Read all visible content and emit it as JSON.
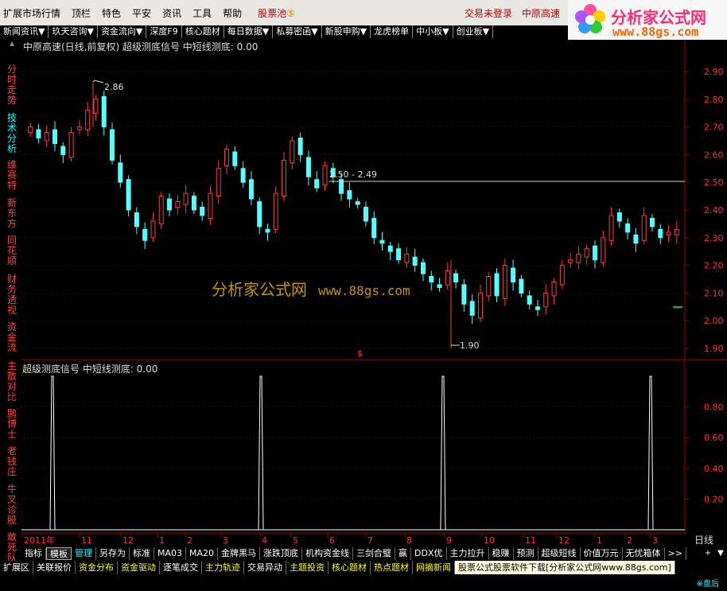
{
  "menu": {
    "items": [
      "扩展市场行情",
      "顶栏",
      "特色",
      "平安",
      "资讯",
      "工具",
      "帮助"
    ],
    "stock_pool": "股票池",
    "stock_pool_badge": "⑤",
    "login": "交易未登录",
    "current_stock": "中原高速"
  },
  "logo": {
    "brand": "分析家公式网",
    "url": "www.88gs.com"
  },
  "nav": [
    "新闻资讯▼",
    "玖天咨询▼",
    "资金流向▼",
    "深度F9",
    "核心题材",
    "每日数据▼",
    "私募密函▼",
    "新股申购▼",
    "龙虎榜单",
    "中小板▼",
    "创业板▼"
  ],
  "sidebar": [
    {
      "label": "分时走势",
      "active": false
    },
    {
      "label": "技术分析",
      "active": true
    },
    {
      "label": "维赛特",
      "active": false
    },
    {
      "label": "新东方",
      "active": false
    },
    {
      "label": "同花顺",
      "active": false
    },
    {
      "label": "财务透视",
      "active": false
    },
    {
      "label": "资金流",
      "active": false
    },
    {
      "label": "主散对比",
      "active": false
    },
    {
      "label": "鹏博士",
      "active": false
    },
    {
      "label": "老钱庄",
      "active": false
    },
    {
      "label": "牛叉诊股",
      "active": false
    },
    {
      "label": "敢死队",
      "active": false
    }
  ],
  "main_title": "中原高速(日线,前复权) 超级测底信号  中短线测底: 0.00",
  "sub_title": "超级测底信号  中短线测底: 0.00",
  "watermark": {
    "text": "分析家公式网",
    "url": "www.88gs.com"
  },
  "toolbar1": [
    "指标",
    "模板",
    "管理",
    "另存为",
    "标准",
    "MA03",
    "MA20",
    "金牌黑马",
    "涨跌顶底",
    "机构资金线",
    "三剑合璧",
    "赢",
    "DDX优",
    "主力拉升",
    "稳赚",
    "预测",
    "超级短线",
    "价值万元",
    "无忧箱体",
    ">>"
  ],
  "toolbar2": [
    "扩展区",
    "关联报价",
    "资金分布",
    "资金驱动",
    "逐笔成交",
    "主力轨迹",
    "交易异动",
    "主题投资",
    "核心题材",
    "热点题材",
    "网摘新闻"
  ],
  "ad_text": "股票公式股票软件下载[分析家公式网www.88gs.com]",
  "status_right": "※盘后",
  "period": "日线",
  "chart_data": [
    {
      "type": "candlestick",
      "title": "中原高速(日线,前复权)",
      "y_ticks": [
        "2.90",
        "2.80",
        "2.70",
        "2.60",
        "2.50",
        "2.40",
        "2.30",
        "2.20",
        "2.10",
        "2.00",
        "1.90"
      ],
      "ylim": [
        1.85,
        2.95
      ],
      "x_ticks": [
        "2011年",
        "11",
        "12",
        "1",
        "2",
        "3",
        "4",
        "5",
        "6",
        "7",
        "8",
        "9",
        "10",
        "11",
        "12",
        "1",
        "2",
        "3"
      ],
      "annotations": [
        "2.86",
        "2.50 - 2.49",
        "1.90"
      ],
      "high": 2.86,
      "low": 1.9,
      "horizontal_line": 2.5,
      "close_series": [
        2.7,
        2.66,
        2.68,
        2.64,
        2.6,
        2.68,
        2.7,
        2.76,
        2.8,
        2.7,
        2.58,
        2.5,
        2.4,
        2.34,
        2.29,
        2.36,
        2.45,
        2.4,
        2.43,
        2.46,
        2.4,
        2.38,
        2.46,
        2.55,
        2.62,
        2.56,
        2.5,
        2.44,
        2.34,
        2.32,
        2.46,
        2.58,
        2.65,
        2.6,
        2.52,
        2.48,
        2.56,
        2.52,
        2.46,
        2.44,
        2.42,
        2.36,
        2.3,
        2.28,
        2.25,
        2.22,
        2.24,
        2.2,
        2.17,
        2.14,
        2.12,
        2.18,
        2.14,
        2.06,
        2.02,
        2.1,
        2.16,
        2.09,
        2.2,
        2.14,
        2.1,
        2.06,
        2.04,
        2.1,
        2.14,
        2.2,
        2.22,
        2.24,
        2.26,
        2.22,
        2.3,
        2.38,
        2.36,
        2.32,
        2.28,
        2.38,
        2.34,
        2.3,
        2.32,
        2.33
      ]
    },
    {
      "type": "line",
      "title": "超级测底信号",
      "series": [
        {
          "name": "中短线测底",
          "values": [
            0.0
          ]
        }
      ],
      "y_ticks": [
        "0.80",
        "0.60",
        "0.40",
        "0.20"
      ],
      "ylim": [
        0,
        1.0
      ],
      "spike_x_months": [
        "11",
        "4",
        "9",
        "3"
      ],
      "spike_value": 1.0
    }
  ]
}
